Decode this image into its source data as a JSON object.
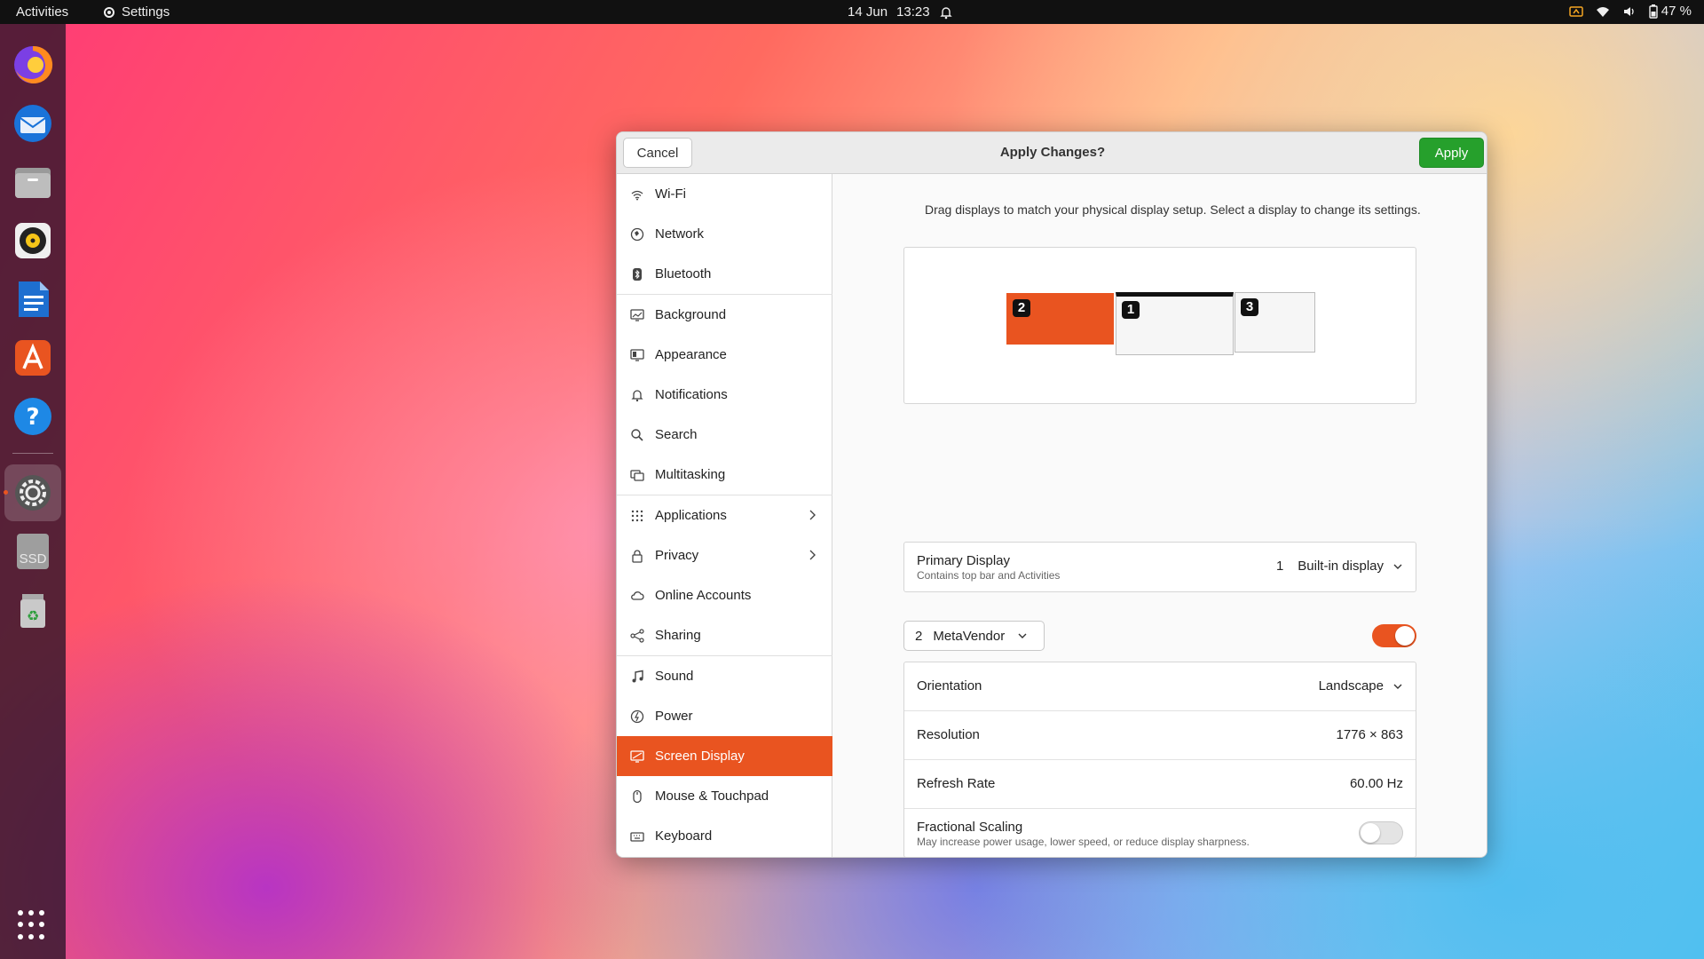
{
  "topbar": {
    "activities": "Activities",
    "app_name": "Settings",
    "date": "14 Jun",
    "time": "13:23",
    "battery": "47 %"
  },
  "dock": {
    "items": [
      "firefox-icon",
      "thunderbird-icon",
      "files-icon",
      "rhythmbox-icon",
      "libreoffice-writer-icon",
      "software-center-icon",
      "help-icon",
      "settings-icon",
      "ssd-drive-icon",
      "trash-icon"
    ],
    "ssd_label": "SSD"
  },
  "window": {
    "cancel_label": "Cancel",
    "title": "Apply Changes?",
    "apply_label": "Apply"
  },
  "sidebar": {
    "items": [
      {
        "label": "Wi-Fi",
        "icon": "wifi-icon"
      },
      {
        "label": "Network",
        "icon": "network-icon"
      },
      {
        "label": "Bluetooth",
        "icon": "bluetooth-icon"
      },
      {
        "label": "Background",
        "icon": "background-icon"
      },
      {
        "label": "Appearance",
        "icon": "appearance-icon"
      },
      {
        "label": "Notifications",
        "icon": "bell-icon"
      },
      {
        "label": "Search",
        "icon": "search-icon"
      },
      {
        "label": "Multitasking",
        "icon": "multitasking-icon"
      },
      {
        "label": "Applications",
        "icon": "apps-grid-icon"
      },
      {
        "label": "Privacy",
        "icon": "lock-icon"
      },
      {
        "label": "Online Accounts",
        "icon": "cloud-icon"
      },
      {
        "label": "Sharing",
        "icon": "share-icon"
      },
      {
        "label": "Sound",
        "icon": "music-note-icon"
      },
      {
        "label": "Power",
        "icon": "power-icon"
      },
      {
        "label": "Screen Display",
        "icon": "display-icon"
      },
      {
        "label": "Mouse & Touchpad",
        "icon": "mouse-icon"
      },
      {
        "label": "Keyboard",
        "icon": "keyboard-icon"
      }
    ],
    "active": "Screen Display"
  },
  "display": {
    "description": "Drag displays to match your physical display setup. Select a display to change its settings.",
    "monitors": [
      {
        "number": "2",
        "selected": true
      },
      {
        "number": "1",
        "primary": true
      },
      {
        "number": "3"
      }
    ],
    "primary": {
      "label": "Primary Display",
      "sublabel": "Contains top bar and Activities",
      "number": "1",
      "value": "Built-in display"
    },
    "selected_monitor": {
      "number": "2",
      "name": "MetaVendor",
      "enabled": true
    },
    "settings": {
      "orientation_label": "Orientation",
      "orientation_value": "Landscape",
      "resolution_label": "Resolution",
      "resolution_value": "1776 × 863",
      "refresh_label": "Refresh Rate",
      "refresh_value": "60.00 Hz",
      "scaling_label": "Fractional Scaling",
      "scaling_sublabel": "May increase power usage, lower speed, or reduce display sharpness.",
      "scaling_enabled": false
    }
  },
  "colors": {
    "accent": "#e95420",
    "apply_green": "#26a02c",
    "topbar": "#111111"
  }
}
